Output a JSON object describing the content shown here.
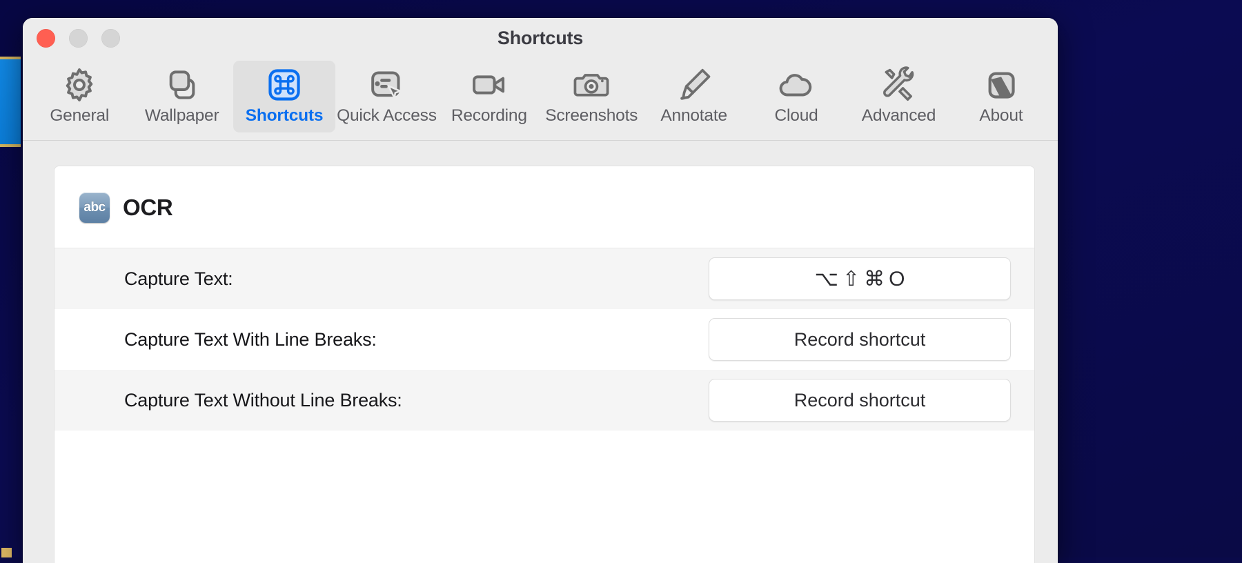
{
  "window": {
    "title": "Shortcuts",
    "traffic_lights": [
      {
        "name": "close",
        "color": "#ff5f52"
      },
      {
        "name": "minimize",
        "color": "#d5d5d5"
      },
      {
        "name": "zoom",
        "color": "#d5d5d5"
      }
    ]
  },
  "toolbar": {
    "selected": "Shortcuts",
    "accent_color": "#0a6ff0",
    "items": [
      {
        "label": "General",
        "icon": "gear-icon"
      },
      {
        "label": "Wallpaper",
        "icon": "windows-stack-icon"
      },
      {
        "label": "Shortcuts",
        "icon": "command-key-icon"
      },
      {
        "label": "Quick Access",
        "icon": "quick-access-cursor-icon"
      },
      {
        "label": "Recording",
        "icon": "video-camera-icon"
      },
      {
        "label": "Screenshots",
        "icon": "camera-icon"
      },
      {
        "label": "Annotate",
        "icon": "highlighter-pen-icon"
      },
      {
        "label": "Cloud",
        "icon": "cloud-icon"
      },
      {
        "label": "Advanced",
        "icon": "wrench-screwdriver-icon"
      },
      {
        "label": "About",
        "icon": "app-logo-icon"
      }
    ]
  },
  "main": {
    "section": {
      "title": "OCR",
      "badge_text": "abc"
    },
    "record_placeholder": "Record shortcut",
    "rows": [
      {
        "label": "Capture Text:",
        "recorded": true,
        "value": "⌥⇧⌘O",
        "keys": [
          "⌥",
          "⇧",
          "⌘",
          "O"
        ]
      },
      {
        "label": "Capture Text With Line Breaks:",
        "recorded": false,
        "value": "Record shortcut"
      },
      {
        "label": "Capture Text Without Line Breaks:",
        "recorded": false,
        "value": "Record shortcut"
      }
    ]
  }
}
